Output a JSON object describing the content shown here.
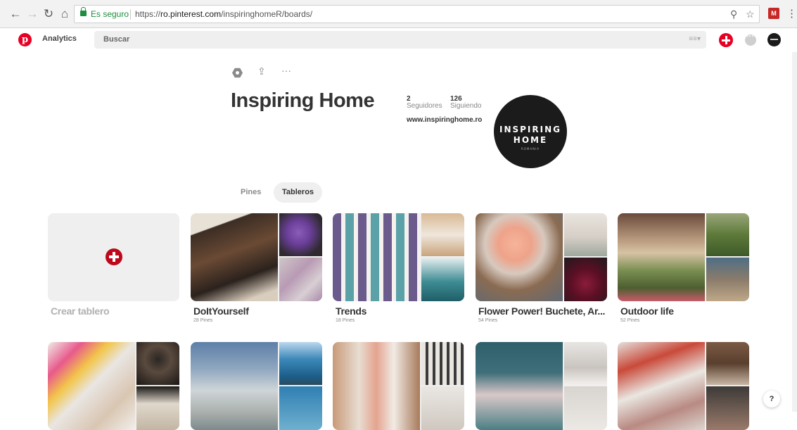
{
  "browser": {
    "secure_label": "Es seguro",
    "url_scheme": "https://",
    "url_host": "ro.pinterest.com",
    "url_path": "/inspiringhomeR/boards/"
  },
  "header": {
    "analytics_label": "Analytics",
    "search_placeholder": "Buscar",
    "brand_color": "#e60023"
  },
  "profile": {
    "name": "Inspiring Home",
    "followers_count": "2",
    "followers_label": "Seguidores",
    "following_count": "126",
    "following_label": "Siguiendo",
    "website": "www.inspiringhome.ro",
    "avatar_line1": "INSPIRING",
    "avatar_line2": "HOME",
    "avatar_line3": "ROMANIA"
  },
  "tabs": [
    {
      "label": "Pines",
      "active": false
    },
    {
      "label": "Tableros",
      "active": true
    }
  ],
  "create_board_label": "Crear tablero",
  "boards": [
    {
      "title": "DoItYourself",
      "count": "28 Pines"
    },
    {
      "title": "Trends",
      "count": "18 Pines"
    },
    {
      "title": "Flower Power! Buchete, Ar...",
      "count": "54 Pines"
    },
    {
      "title": "Outdoor life",
      "count": "52 Pines"
    }
  ],
  "help_label": "?"
}
